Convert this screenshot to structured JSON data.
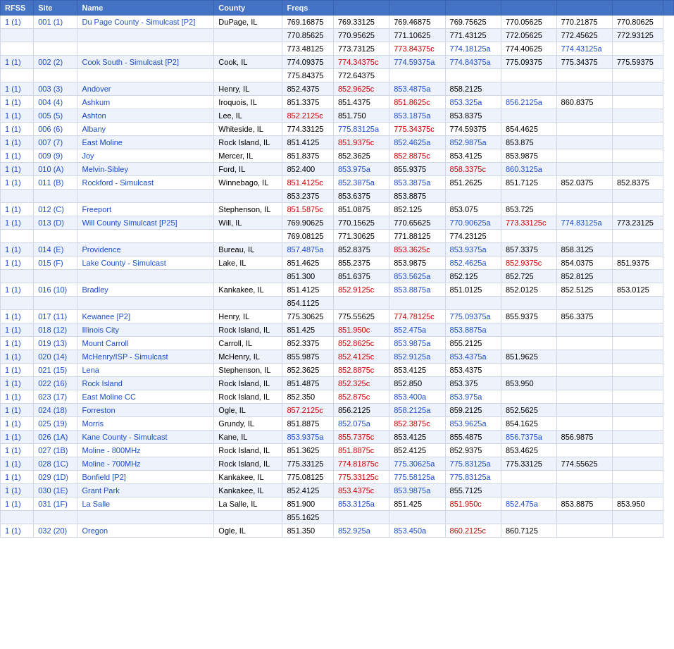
{
  "headers": [
    "RFSS",
    "Site",
    "Name",
    "County",
    "Freqs",
    "",
    "",
    "",
    "",
    "",
    "",
    ""
  ],
  "rows": [
    {
      "rfss": "1 (1)",
      "site": "001 (1)",
      "name": "Du Page County - Simulcast [P2]",
      "county": "DuPage, IL",
      "freqs": [
        "769.16875",
        "769.33125",
        "769.46875",
        "769.75625",
        "770.05625",
        "770.21875",
        "770.80625"
      ],
      "styles": [
        "",
        "",
        "",
        "",
        "",
        "",
        ""
      ]
    },
    {
      "rfss": "",
      "site": "",
      "name": "",
      "county": "",
      "freqs": [
        "770.85625",
        "770.95625",
        "771.10625",
        "771.43125",
        "772.05625",
        "772.45625",
        "772.93125"
      ],
      "styles": [
        "",
        "",
        "",
        "",
        "",
        "",
        ""
      ]
    },
    {
      "rfss": "",
      "site": "",
      "name": "",
      "county": "",
      "freqs": [
        "773.48125",
        "773.73125",
        "773.84375c",
        "774.18125a",
        "774.40625",
        "774.43125a",
        ""
      ],
      "styles": [
        "",
        "",
        "red",
        "blue-link",
        "",
        "blue-link",
        ""
      ]
    },
    {
      "rfss": "1 (1)",
      "site": "002 (2)",
      "name": "Cook South - Simulcast [P2]",
      "county": "Cook, IL",
      "freqs": [
        "774.09375",
        "774.34375c",
        "774.59375a",
        "774.84375a",
        "775.09375",
        "775.34375",
        "775.59375"
      ],
      "styles": [
        "",
        "red",
        "blue-link",
        "blue-link",
        "",
        "",
        ""
      ]
    },
    {
      "rfss": "",
      "site": "",
      "name": "",
      "county": "",
      "freqs": [
        "775.84375",
        "772.64375",
        "",
        "",
        "",
        "",
        ""
      ],
      "styles": [
        "",
        "",
        "",
        "",
        "",
        "",
        ""
      ]
    },
    {
      "rfss": "1 (1)",
      "site": "003 (3)",
      "name": "Andover",
      "county": "Henry, IL",
      "freqs": [
        "852.4375",
        "852.9625c",
        "853.4875a",
        "858.2125",
        "",
        "",
        ""
      ],
      "styles": [
        "",
        "red",
        "blue-link",
        "",
        "",
        "",
        ""
      ]
    },
    {
      "rfss": "1 (1)",
      "site": "004 (4)",
      "name": "Ashkum",
      "county": "Iroquois, IL",
      "freqs": [
        "851.3375",
        "851.4375",
        "851.8625c",
        "853.325a",
        "856.2125a",
        "860.8375",
        ""
      ],
      "styles": [
        "",
        "",
        "red",
        "blue-link",
        "blue-link",
        "",
        ""
      ]
    },
    {
      "rfss": "1 (1)",
      "site": "005 (5)",
      "name": "Ashton",
      "county": "Lee, IL",
      "freqs": [
        "852.2125c",
        "851.750",
        "853.1875a",
        "853.8375",
        "",
        "",
        ""
      ],
      "styles": [
        "red",
        "",
        "blue-link",
        "",
        "",
        "",
        ""
      ]
    },
    {
      "rfss": "1 (1)",
      "site": "006 (6)",
      "name": "Albany",
      "county": "Whiteside, IL",
      "freqs": [
        "774.33125",
        "775.83125a",
        "775.34375c",
        "774.59375",
        "854.4625",
        "",
        ""
      ],
      "styles": [
        "",
        "blue-link",
        "red",
        "",
        "",
        "",
        ""
      ]
    },
    {
      "rfss": "1 (1)",
      "site": "007 (7)",
      "name": "East Moline",
      "county": "Rock Island, IL",
      "freqs": [
        "851.4125",
        "851.9375c",
        "852.4625a",
        "852.9875a",
        "853.875",
        "",
        ""
      ],
      "styles": [
        "",
        "red",
        "blue-link",
        "blue-link",
        "",
        "",
        ""
      ]
    },
    {
      "rfss": "1 (1)",
      "site": "009 (9)",
      "name": "Joy",
      "county": "Mercer, IL",
      "freqs": [
        "851.8375",
        "852.3625",
        "852.8875c",
        "853.4125",
        "853.9875",
        "",
        ""
      ],
      "styles": [
        "",
        "",
        "red",
        "",
        "",
        "",
        ""
      ]
    },
    {
      "rfss": "1 (1)",
      "site": "010 (A)",
      "name": "Melvin-Sibley",
      "county": "Ford, IL",
      "freqs": [
        "852.400",
        "853.975a",
        "855.9375",
        "858.3375c",
        "860.3125a",
        "",
        ""
      ],
      "styles": [
        "",
        "blue-link",
        "",
        "red",
        "blue-link",
        "",
        ""
      ]
    },
    {
      "rfss": "1 (1)",
      "site": "011 (B)",
      "name": "Rockford - Simulcast",
      "county": "Winnebago, IL",
      "freqs": [
        "851.4125c",
        "852.3875a",
        "853.3875a",
        "851.2625",
        "851.7125",
        "852.0375",
        "852.8375"
      ],
      "styles": [
        "red",
        "blue-link",
        "blue-link",
        "",
        "",
        "",
        ""
      ]
    },
    {
      "rfss": "",
      "site": "",
      "name": "",
      "county": "",
      "freqs": [
        "853.2375",
        "853.6375",
        "853.8875",
        "",
        "",
        "",
        ""
      ],
      "styles": [
        "",
        "",
        "",
        "",
        "",
        "",
        ""
      ]
    },
    {
      "rfss": "1 (1)",
      "site": "012 (C)",
      "name": "Freeport",
      "county": "Stephenson, IL",
      "freqs": [
        "851.5875c",
        "851.0875",
        "852.125",
        "853.075",
        "853.725",
        "",
        ""
      ],
      "styles": [
        "red",
        "",
        "",
        "",
        "",
        "",
        ""
      ]
    },
    {
      "rfss": "1 (1)",
      "site": "013 (D)",
      "name": "Will County Simulcast [P25]",
      "county": "Will, IL",
      "freqs": [
        "769.90625",
        "770.15625",
        "770.65625",
        "770.90625a",
        "773.33125c",
        "774.83125a",
        "773.23125"
      ],
      "styles": [
        "",
        "",
        "",
        "blue-link",
        "red",
        "blue-link",
        ""
      ]
    },
    {
      "rfss": "",
      "site": "",
      "name": "",
      "county": "",
      "freqs": [
        "769.08125",
        "771.30625",
        "771.88125",
        "774.23125",
        "",
        "",
        ""
      ],
      "styles": [
        "",
        "",
        "",
        "",
        "",
        "",
        ""
      ]
    },
    {
      "rfss": "1 (1)",
      "site": "014 (E)",
      "name": "Providence",
      "county": "Bureau, IL",
      "freqs": [
        "857.4875a",
        "852.8375",
        "853.3625c",
        "853.9375a",
        "857.3375",
        "858.3125",
        ""
      ],
      "styles": [
        "blue-link",
        "",
        "red",
        "blue-link",
        "",
        "",
        ""
      ]
    },
    {
      "rfss": "1 (1)",
      "site": "015 (F)",
      "name": "Lake County - Simulcast",
      "county": "Lake, IL",
      "freqs": [
        "851.4625",
        "855.2375",
        "853.9875",
        "852.4625a",
        "852.9375c",
        "854.0375",
        "851.9375"
      ],
      "styles": [
        "",
        "",
        "",
        "blue-link",
        "red",
        "",
        ""
      ]
    },
    {
      "rfss": "",
      "site": "",
      "name": "",
      "county": "",
      "freqs": [
        "851.300",
        "851.6375",
        "853.5625a",
        "852.125",
        "852.725",
        "852.8125",
        ""
      ],
      "styles": [
        "",
        "",
        "blue-link",
        "",
        "",
        "",
        ""
      ]
    },
    {
      "rfss": "1 (1)",
      "site": "016 (10)",
      "name": "Bradley",
      "county": "Kankakee, IL",
      "freqs": [
        "851.4125",
        "852.9125c",
        "853.8875a",
        "851.0125",
        "852.0125",
        "852.5125",
        "853.0125"
      ],
      "styles": [
        "",
        "red",
        "blue-link",
        "",
        "",
        "",
        ""
      ]
    },
    {
      "rfss": "",
      "site": "",
      "name": "",
      "county": "",
      "freqs": [
        "854.1125",
        "",
        "",
        "",
        "",
        "",
        ""
      ],
      "styles": [
        "",
        "",
        "",
        "",
        "",
        "",
        ""
      ]
    },
    {
      "rfss": "1 (1)",
      "site": "017 (11)",
      "name": "Kewanee [P2]",
      "county": "Henry, IL",
      "freqs": [
        "775.30625",
        "775.55625",
        "774.78125c",
        "775.09375a",
        "855.9375",
        "856.3375",
        ""
      ],
      "styles": [
        "",
        "",
        "red",
        "blue-link",
        "",
        "",
        ""
      ]
    },
    {
      "rfss": "1 (1)",
      "site": "018 (12)",
      "name": "Illinois City",
      "county": "Rock Island, IL",
      "freqs": [
        "851.425",
        "851.950c",
        "852.475a",
        "853.8875a",
        "",
        "",
        ""
      ],
      "styles": [
        "",
        "red",
        "blue-link",
        "blue-link",
        "",
        "",
        ""
      ]
    },
    {
      "rfss": "1 (1)",
      "site": "019 (13)",
      "name": "Mount Carroll",
      "county": "Carroll, IL",
      "freqs": [
        "852.3375",
        "852.8625c",
        "853.9875a",
        "855.2125",
        "",
        "",
        ""
      ],
      "styles": [
        "",
        "red",
        "blue-link",
        "",
        "",
        "",
        ""
      ]
    },
    {
      "rfss": "1 (1)",
      "site": "020 (14)",
      "name": "McHenry/ISP - Simulcast",
      "county": "McHenry, IL",
      "freqs": [
        "855.9875",
        "852.4125c",
        "852.9125a",
        "853.4375a",
        "851.9625",
        "",
        ""
      ],
      "styles": [
        "",
        "red",
        "blue-link",
        "blue-link",
        "",
        "",
        ""
      ]
    },
    {
      "rfss": "1 (1)",
      "site": "021 (15)",
      "name": "Lena",
      "county": "Stephenson, IL",
      "freqs": [
        "852.3625",
        "852.8875c",
        "853.4125",
        "853.4375",
        "",
        "",
        ""
      ],
      "styles": [
        "",
        "red",
        "",
        "",
        "",
        "",
        ""
      ]
    },
    {
      "rfss": "1 (1)",
      "site": "022 (16)",
      "name": "Rock Island",
      "county": "Rock Island, IL",
      "freqs": [
        "851.4875",
        "852.325c",
        "852.850",
        "853.375",
        "853.950",
        "",
        ""
      ],
      "styles": [
        "",
        "red",
        "",
        "",
        "",
        "",
        ""
      ]
    },
    {
      "rfss": "1 (1)",
      "site": "023 (17)",
      "name": "East Moline CC",
      "county": "Rock Island, IL",
      "freqs": [
        "852.350",
        "852.875c",
        "853.400a",
        "853.975a",
        "",
        "",
        ""
      ],
      "styles": [
        "",
        "red",
        "blue-link",
        "blue-link",
        "",
        "",
        ""
      ]
    },
    {
      "rfss": "1 (1)",
      "site": "024 (18)",
      "name": "Forreston",
      "county": "Ogle, IL",
      "freqs": [
        "857.2125c",
        "856.2125",
        "858.2125a",
        "859.2125",
        "852.5625",
        "",
        ""
      ],
      "styles": [
        "red",
        "",
        "blue-link",
        "",
        "",
        "",
        ""
      ]
    },
    {
      "rfss": "1 (1)",
      "site": "025 (19)",
      "name": "Morris",
      "county": "Grundy, IL",
      "freqs": [
        "851.8875",
        "852.075a",
        "852.3875c",
        "853.9625a",
        "854.1625",
        "",
        ""
      ],
      "styles": [
        "",
        "blue-link",
        "red",
        "blue-link",
        "",
        "",
        ""
      ]
    },
    {
      "rfss": "1 (1)",
      "site": "026 (1A)",
      "name": "Kane County - Simulcast",
      "county": "Kane, IL",
      "freqs": [
        "853.9375a",
        "855.7375c",
        "853.4125",
        "855.4875",
        "856.7375a",
        "856.9875",
        ""
      ],
      "styles": [
        "blue-link",
        "red",
        "",
        "",
        "blue-link",
        "",
        ""
      ]
    },
    {
      "rfss": "1 (1)",
      "site": "027 (1B)",
      "name": "Moline - 800MHz",
      "county": "Rock Island, IL",
      "freqs": [
        "851.3625",
        "851.8875c",
        "852.4125",
        "852.9375",
        "853.4625",
        "",
        ""
      ],
      "styles": [
        "",
        "red",
        "",
        "",
        "",
        "",
        ""
      ]
    },
    {
      "rfss": "1 (1)",
      "site": "028 (1C)",
      "name": "Moline - 700MHz",
      "county": "Rock Island, IL",
      "freqs": [
        "775.33125",
        "774.81875c",
        "775.30625a",
        "775.83125a",
        "775.33125",
        "774.55625",
        ""
      ],
      "styles": [
        "",
        "red",
        "blue-link",
        "blue-link",
        "",
        "",
        ""
      ]
    },
    {
      "rfss": "1 (1)",
      "site": "029 (1D)",
      "name": "Bonfield [P2]",
      "county": "Kankakee, IL",
      "freqs": [
        "775.08125",
        "775.33125c",
        "775.58125a",
        "775.83125a",
        "",
        "",
        ""
      ],
      "styles": [
        "",
        "red",
        "blue-link",
        "blue-link",
        "",
        "",
        ""
      ]
    },
    {
      "rfss": "1 (1)",
      "site": "030 (1E)",
      "name": "Grant Park",
      "county": "Kankakee, IL",
      "freqs": [
        "852.4125",
        "853.4375c",
        "853.9875a",
        "855.7125",
        "",
        "",
        ""
      ],
      "styles": [
        "",
        "red",
        "blue-link",
        "",
        "",
        "",
        ""
      ]
    },
    {
      "rfss": "1 (1)",
      "site": "031 (1F)",
      "name": "La Salle",
      "county": "La Salle, IL",
      "freqs": [
        "851.900",
        "853.3125a",
        "851.425",
        "851.950c",
        "852.475a",
        "853.8875",
        "853.950"
      ],
      "styles": [
        "",
        "blue-link",
        "",
        "red",
        "blue-link",
        "",
        ""
      ]
    },
    {
      "rfss": "",
      "site": "",
      "name": "",
      "county": "",
      "freqs": [
        "855.1625",
        "",
        "",
        "",
        "",
        "",
        ""
      ],
      "styles": [
        "",
        "",
        "",
        "",
        "",
        "",
        ""
      ]
    },
    {
      "rfss": "1 (1)",
      "site": "032 (20)",
      "name": "Oregon",
      "county": "Ogle, IL",
      "freqs": [
        "851.350",
        "852.925a",
        "853.450a",
        "860.2125c",
        "860.7125",
        "",
        ""
      ],
      "styles": [
        "",
        "blue-link",
        "blue-link",
        "red",
        "",
        "",
        ""
      ]
    }
  ]
}
